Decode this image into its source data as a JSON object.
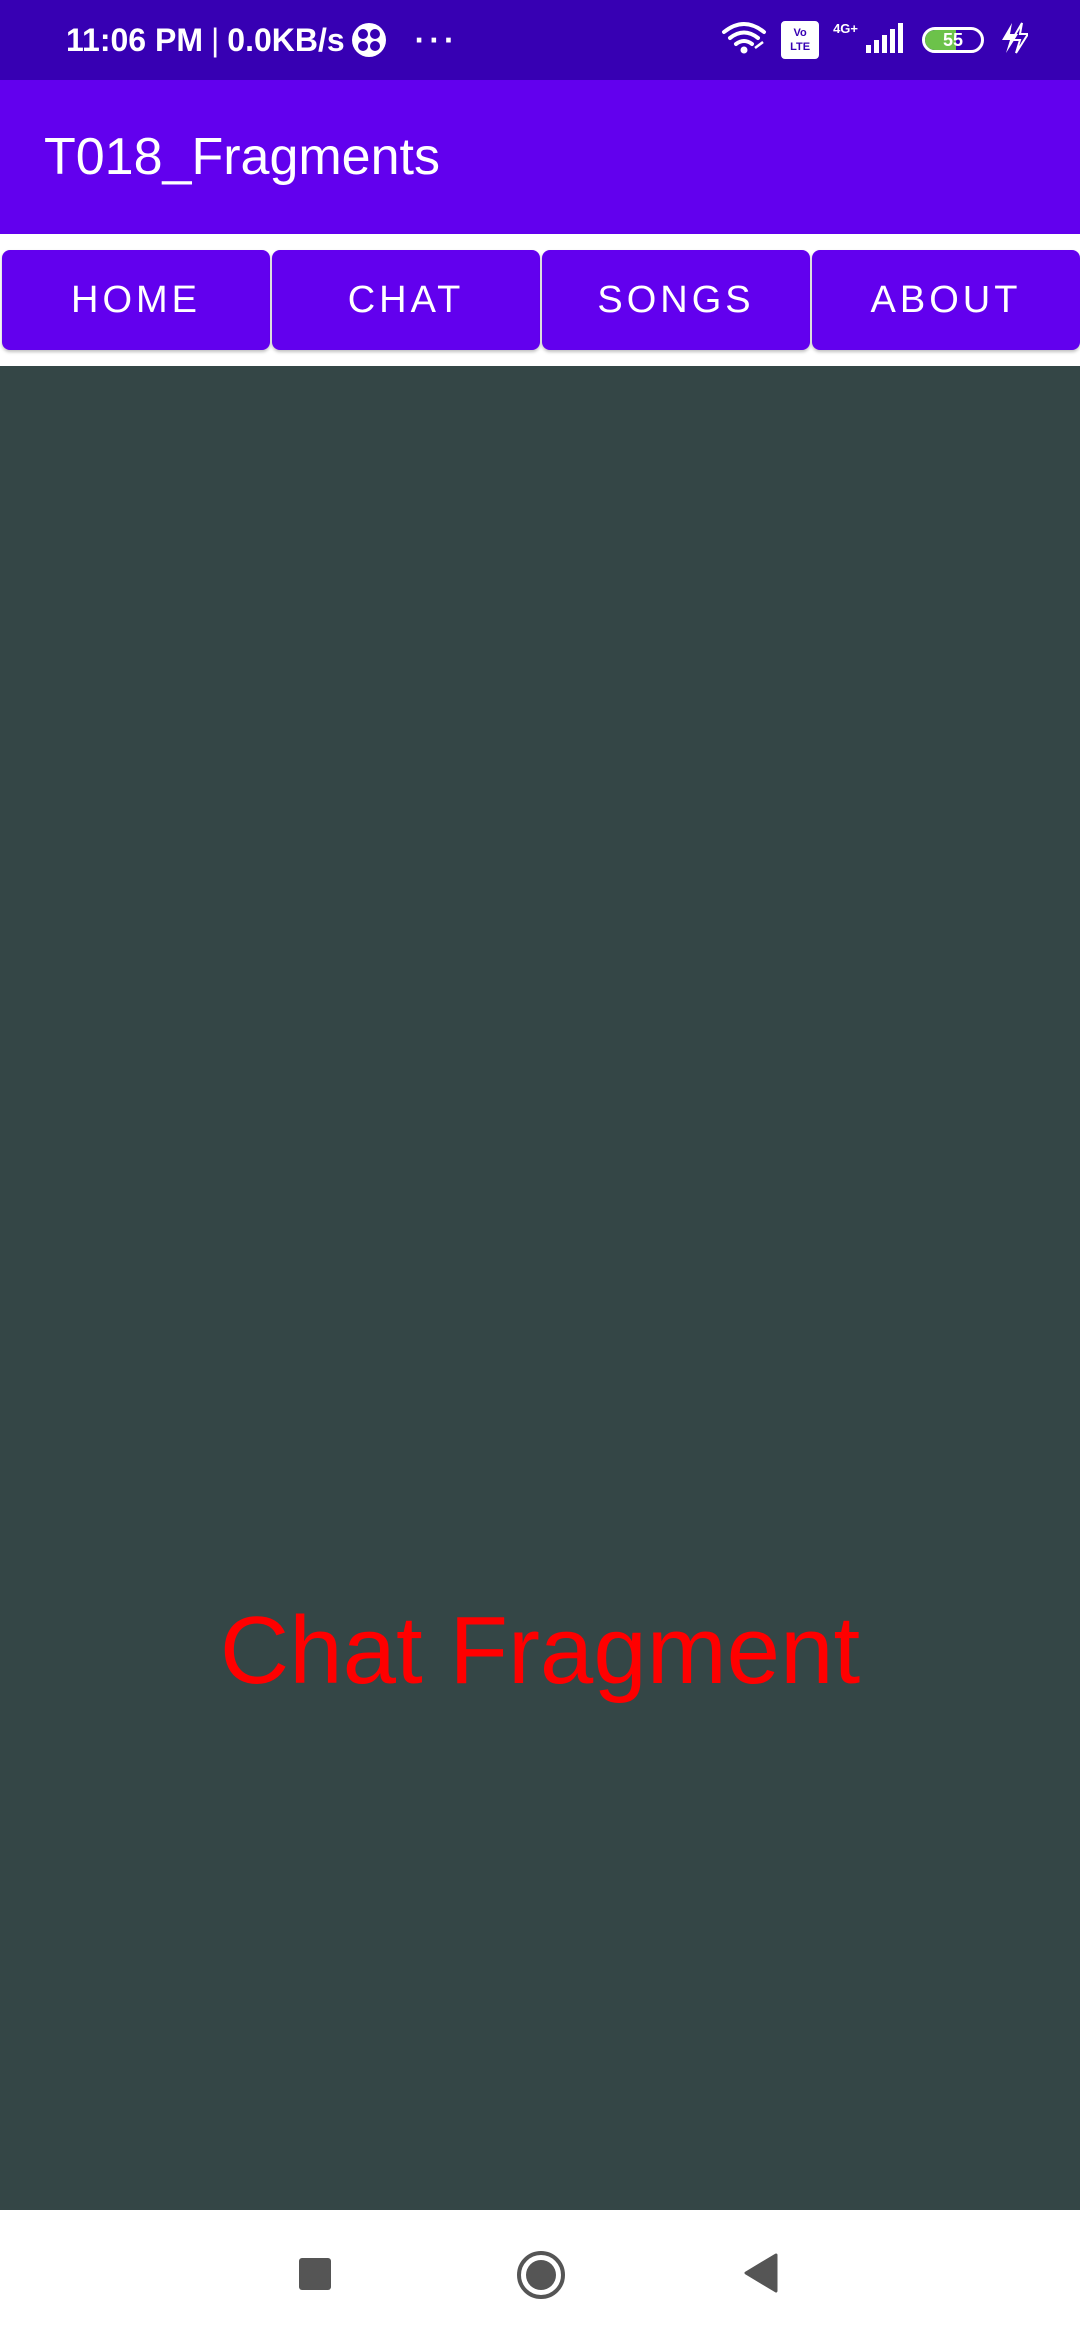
{
  "status_bar": {
    "time": "11:06 PM",
    "separator": "|",
    "net_speed": "0.0KB/s",
    "more_dots": "···",
    "volte_top": "Vo",
    "volte_bottom": "LTE",
    "network_type": "4G+",
    "battery_level": "55",
    "battery_fraction": 0.55,
    "icons": [
      "fan-icon",
      "wifi-icon",
      "volte-icon",
      "signal-icon",
      "battery-icon",
      "charging-icon"
    ]
  },
  "app_bar": {
    "title": "T018_Fragments"
  },
  "tabs": [
    {
      "label": "HOME"
    },
    {
      "label": "CHAT"
    },
    {
      "label": "SONGS"
    },
    {
      "label": "ABOUT"
    }
  ],
  "fragment": {
    "text": "Chat Fragment"
  },
  "nav_bar": {
    "icons": [
      "recents-icon",
      "home-icon",
      "back-icon"
    ]
  },
  "colors": {
    "status_bar": "#3700b3",
    "primary": "#6200ee",
    "fragment_bg": "#344646",
    "fragment_text": "#ff0000",
    "battery_fill": "#6cc24a"
  }
}
